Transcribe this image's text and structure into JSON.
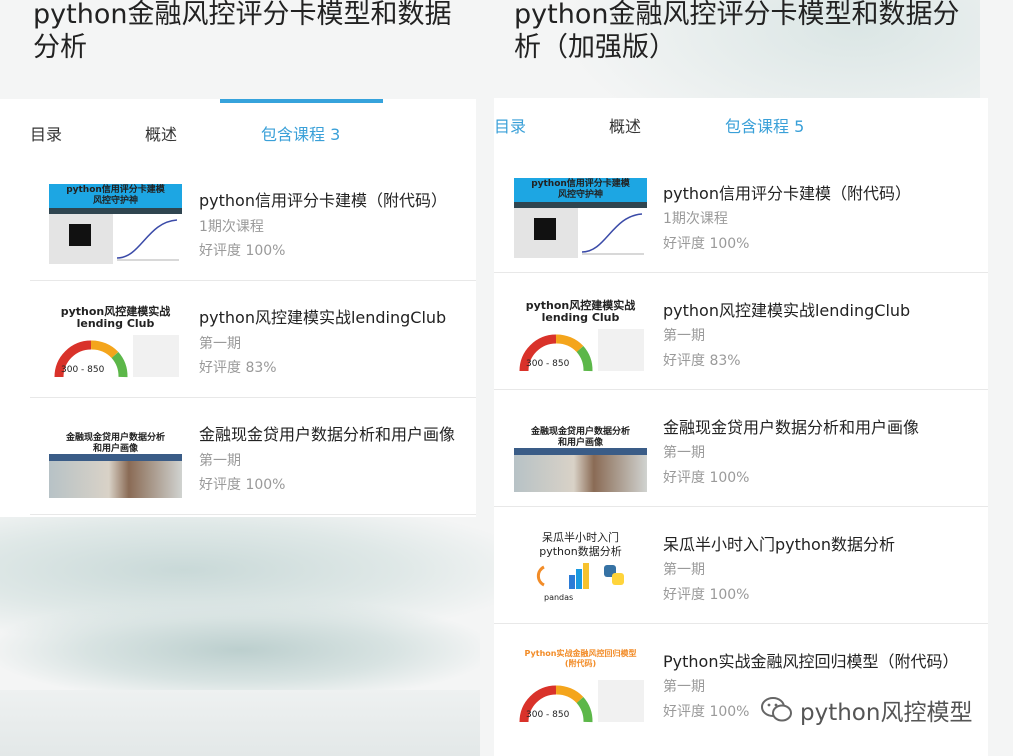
{
  "left": {
    "title": "python金融风控评分卡模型和数据分析",
    "tabs": {
      "catalog": "目录",
      "overview": "概述",
      "courses": "包含课程 3"
    },
    "courses": [
      {
        "name": "python信用评分卡建模（附代码）",
        "sub": "1期次课程",
        "rating": "好评度 100%",
        "thumb_line1": "python信用评分卡建模",
        "thumb_line2": "风控守护神"
      },
      {
        "name": "python风控建模实战lendingClub",
        "sub": "第一期",
        "rating": "好评度 83%",
        "thumb_line1": "python风控建模实战",
        "thumb_line2": "lending Club",
        "thumb_score": "300 - 850"
      },
      {
        "name": "金融现金贷用户数据分析和用户画像",
        "sub": "第一期",
        "rating": "好评度 100%",
        "thumb_line1": "金融现金贷用户数据分析",
        "thumb_line2": "和用户画像"
      }
    ]
  },
  "right": {
    "title": "python金融风控评分卡模型和数据分析（加强版）",
    "tabs": {
      "catalog": "目录",
      "overview": "概述",
      "courses": "包含课程 5"
    },
    "courses": [
      {
        "name": "python信用评分卡建模（附代码）",
        "sub": "1期次课程",
        "rating": "好评度 100%",
        "thumb_line1": "python信用评分卡建模",
        "thumb_line2": "风控守护神"
      },
      {
        "name": "python风控建模实战lendingClub",
        "sub": "第一期",
        "rating": "好评度 83%",
        "thumb_line1": "python风控建模实战",
        "thumb_line2": "lending Club",
        "thumb_score": "300 - 850"
      },
      {
        "name": "金融现金贷用户数据分析和用户画像",
        "sub": "第一期",
        "rating": "好评度 100%",
        "thumb_line1": "金融现金贷用户数据分析",
        "thumb_line2": "和用户画像"
      },
      {
        "name": "呆瓜半小时入门python数据分析",
        "sub": "第一期",
        "rating": "好评度 100%",
        "thumb_line1": "呆瓜半小时入门",
        "thumb_line2": "python数据分析",
        "thumb_line3": "pandas"
      },
      {
        "name": "Python实战金融风控回归模型（附代码）",
        "sub": "第一期",
        "rating": "好评度 100%",
        "thumb_line1": "Python实战金融风控回归模型",
        "thumb_line2": "(附代码)",
        "thumb_score": "300 - 850"
      }
    ]
  },
  "watermark": {
    "text": "python风控模型"
  },
  "colors": {
    "accent": "#36a3dc",
    "text": "#222222",
    "muted": "#9a9a9a"
  }
}
